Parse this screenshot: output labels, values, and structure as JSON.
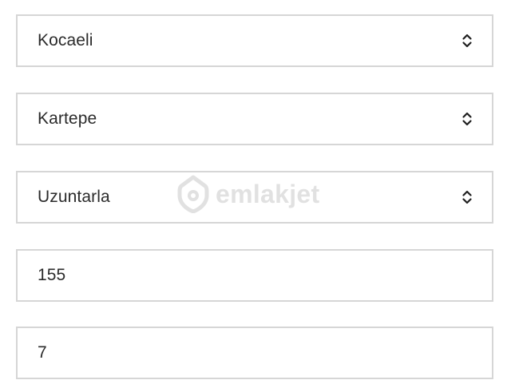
{
  "form": {
    "province": {
      "value": "Kocaeli",
      "icon": "select-chevron-icon"
    },
    "district": {
      "value": "Kartepe",
      "icon": "select-chevron-icon"
    },
    "neighborhood": {
      "value": "Uzuntarla",
      "icon": "select-chevron-icon"
    },
    "field4": {
      "value": "155"
    },
    "field5": {
      "value": "7"
    }
  },
  "watermark": {
    "text": "emlakjet",
    "icon": "location-home-pin-icon",
    "color": "#b9b9b9"
  },
  "colors": {
    "border": "#d6d6d6",
    "text": "#2b2b2b",
    "background": "#ffffff"
  }
}
